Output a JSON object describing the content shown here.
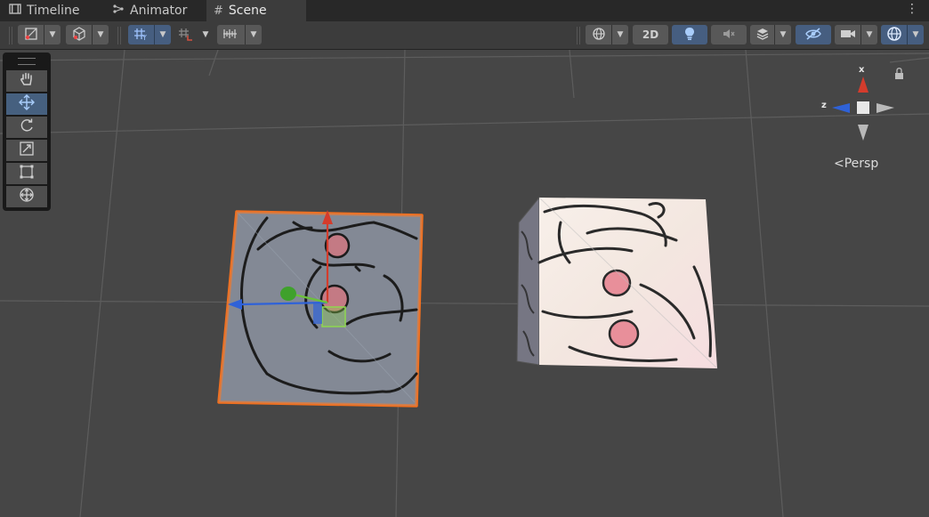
{
  "tabs": [
    {
      "label": "Timeline",
      "icon": "film-icon",
      "active": false
    },
    {
      "label": "Animator",
      "icon": "animator-icon",
      "active": false
    },
    {
      "label": "Scene",
      "icon": "hash-icon",
      "active": true
    }
  ],
  "toolbar": {
    "mode_2d_label": "2D",
    "lighting_on": true,
    "scene_visibility_on": true,
    "gizmos_on": true
  },
  "tools": [
    {
      "name": "hand-tool",
      "icon": "hand-icon",
      "active": false
    },
    {
      "name": "move-tool",
      "icon": "move-arrows-icon",
      "active": true
    },
    {
      "name": "rotate-tool",
      "icon": "rotate-icon",
      "active": false
    },
    {
      "name": "scale-tool",
      "icon": "scale-icon",
      "active": false
    },
    {
      "name": "rect-tool",
      "icon": "rect-icon",
      "active": false
    },
    {
      "name": "transform-tool",
      "icon": "transform-icon",
      "active": false
    }
  ],
  "orientation_gizmo": {
    "x_label": "x",
    "z_label": "z",
    "projection_label": "Persp"
  },
  "colors": {
    "axis_x": "#d43c2c",
    "axis_y": "#6cc23a",
    "axis_z": "#2f62d8",
    "selection_outline": "#f07020",
    "active_tool": "#46607f"
  }
}
